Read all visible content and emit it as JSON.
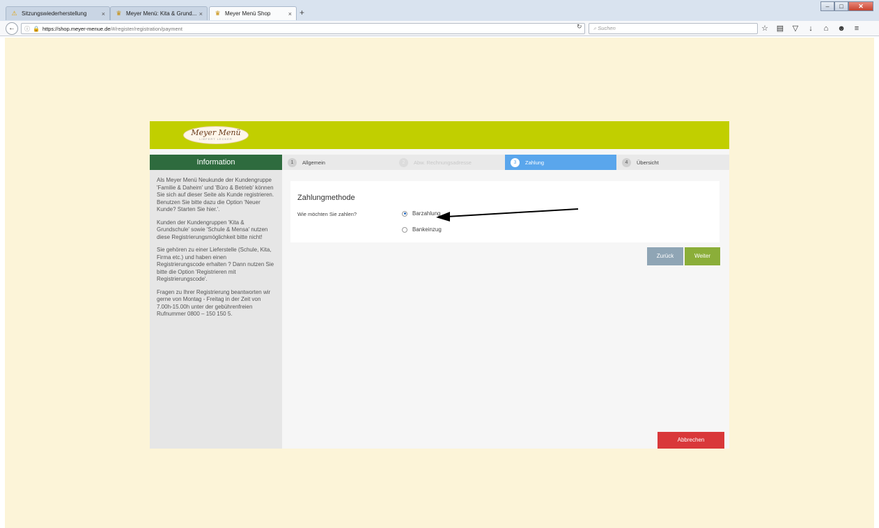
{
  "browser": {
    "tabs": [
      {
        "label": "Sitzungswiederherstellung",
        "icon": "warning-icon"
      },
      {
        "label": "Meyer Menü: Kita & Grund...",
        "icon": "meyer-favicon"
      },
      {
        "label": "Meyer Menü Shop",
        "icon": "meyer-favicon"
      }
    ],
    "new_tab": "+",
    "url_domain": "https://shop.meyer-menue.de",
    "url_path": "/#/register/registration/payment",
    "search_placeholder": "Suchen"
  },
  "logo": {
    "name": "Meyer Menü",
    "tagline": "LIEFERT LECKER"
  },
  "sidebar": {
    "title": "Information",
    "paragraphs": [
      "Als Meyer Menü Neukunde der Kundengruppe 'Familie & Daheim' und 'Büro & Betrieb' können Sie sich auf dieser Seite als Kunde registrieren. Benutzen Sie bitte dazu die Option 'Neuer Kunde? Starten Sie hier.'.",
      "Kunden der Kundengruppen 'Kita & Grundschule' sowie 'Schule & Mensa' nutzen diese Registrierungsmöglichkeit bitte nicht!",
      "Sie gehören zu einer Lieferstelle (Schule, Kita, Firma etc.) und haben einen Registrierungscode erhalten ? Dann nutzen Sie bitte die Option 'Registrieren mit Registrierungscode'.",
      "Fragen zu Ihrer Registrierung beantworten wir gerne von Montag - Freitag in der Zeit von 7.00h-15.00h unter der gebührenfreien Rufnummer 0800 – 150 150 5."
    ]
  },
  "steps": [
    {
      "num": "1",
      "label": "Allgemein"
    },
    {
      "num": "2",
      "label": "Abw. Rechnungsadresse"
    },
    {
      "num": "3",
      "label": "Zahlung"
    },
    {
      "num": "4",
      "label": "Übersicht"
    }
  ],
  "payment": {
    "title": "Zahlungmethode",
    "question": "Wie möchten Sie zahlen?",
    "options": [
      {
        "label": "Barzahlung",
        "checked": true
      },
      {
        "label": "Bankeinzug",
        "checked": false
      }
    ]
  },
  "buttons": {
    "back": "Zurück",
    "next": "Weiter",
    "cancel": "Abbrechen"
  },
  "colors": {
    "header": "#c1cf00",
    "sidebar_head": "#2e6b3e",
    "active_step": "#5aa6ec",
    "next": "#8bae39",
    "cancel": "#d9383a",
    "page_bg": "#fcf4d8"
  }
}
